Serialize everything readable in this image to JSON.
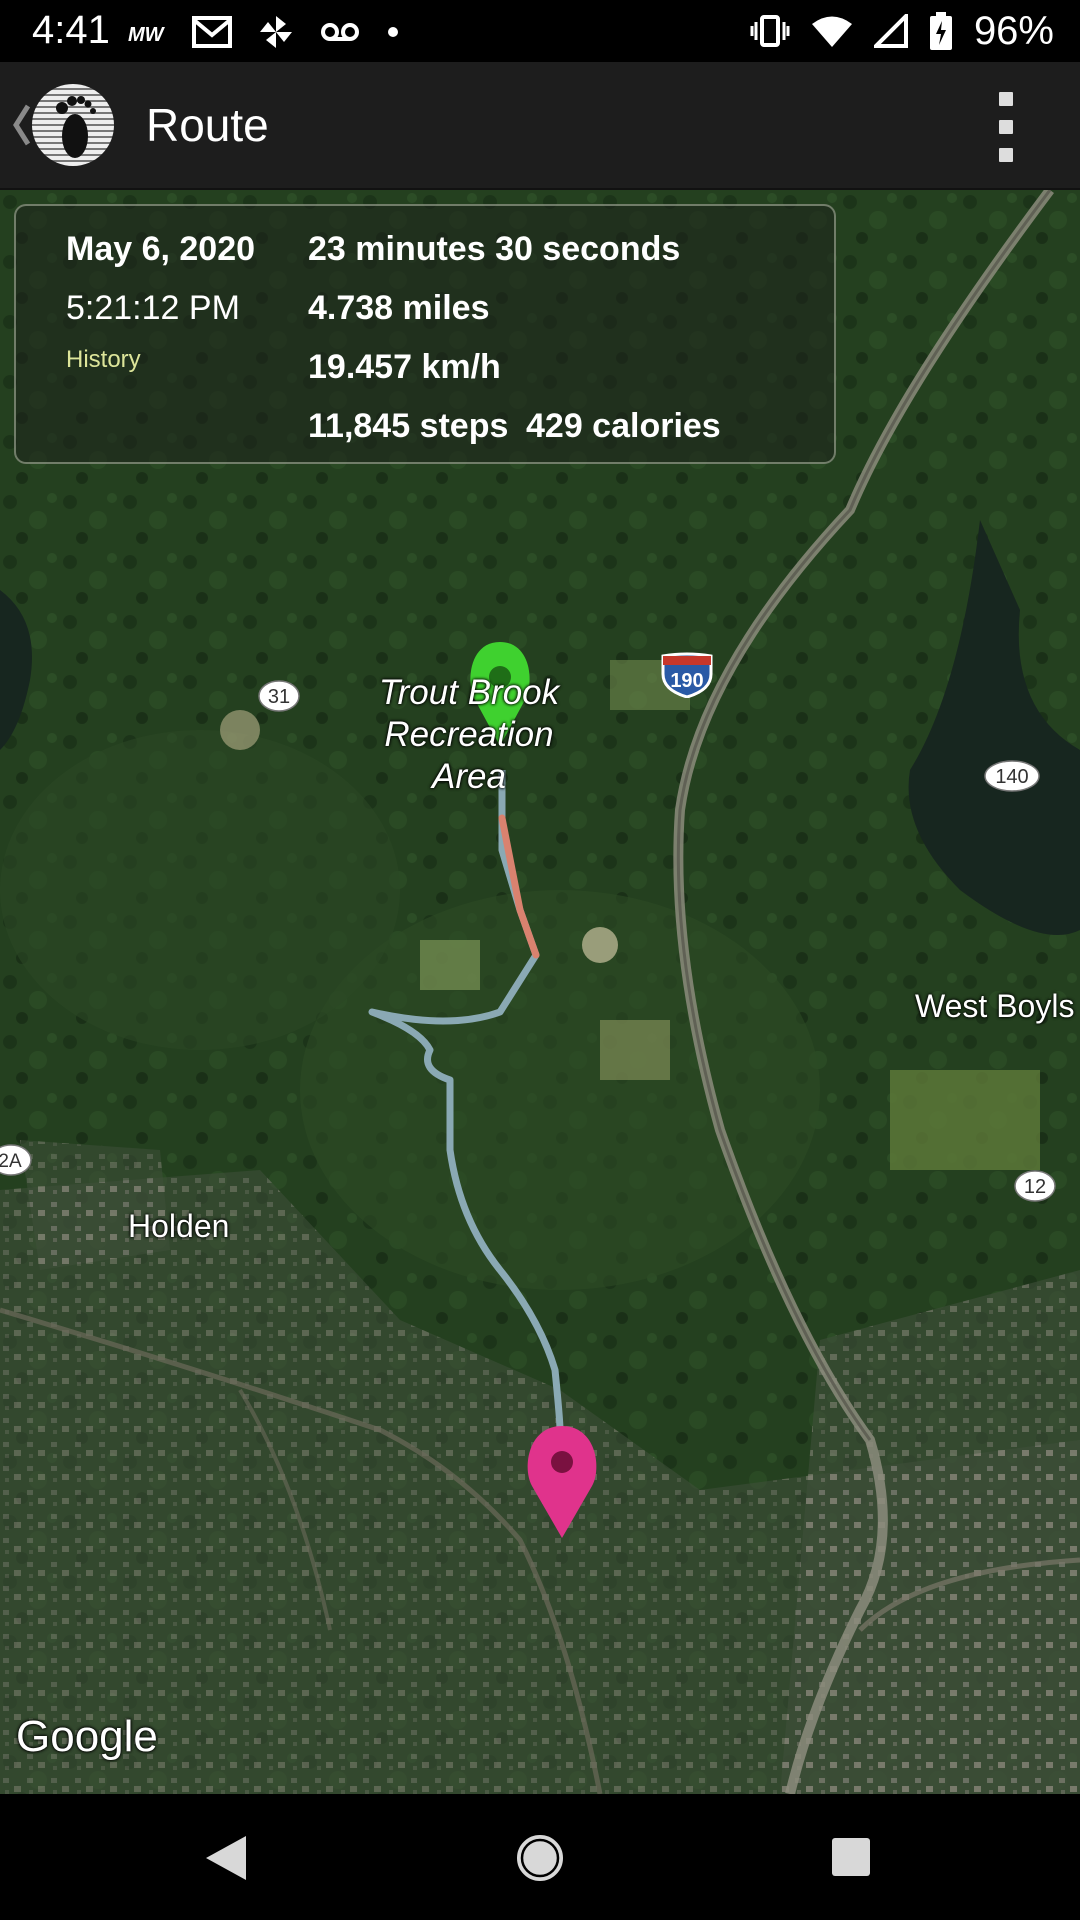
{
  "status_bar": {
    "time": "4:41",
    "battery_percent": "96%",
    "left_icons": [
      "mw-icon",
      "gmail-icon",
      "pinwheel-icon",
      "voicemail-icon",
      "dot-icon"
    ],
    "right_icons": [
      "vibrate-icon",
      "wifi-icon",
      "signal-icon",
      "battery-charging-icon"
    ]
  },
  "app_bar": {
    "title": "Route",
    "logo": "footprint-logo",
    "menu": "overflow-menu-icon"
  },
  "info": {
    "date": "May 6, 2020",
    "time": "5:21:12 PM",
    "history_link": "History",
    "duration": "23 minutes 30 seconds",
    "distance": "4.738 miles",
    "speed": "19.457 km/h",
    "steps": "11,845 steps",
    "calories": "429 calories"
  },
  "map": {
    "labels": {
      "area_line1": "Trout Brook",
      "area_line2": "Recreation",
      "area_line3": "Area",
      "west_boylston": "West Boyls",
      "holden": "Holden"
    },
    "shields": {
      "r31": "31",
      "i190": "190",
      "r140": "140",
      "r12": "12",
      "r122a": "2A"
    },
    "google_logo": "Google",
    "colors": {
      "route": "#8aa9b4",
      "route_fast": "#d9826f",
      "start_marker": "#3fd12f",
      "end_marker": "#e0338c"
    }
  },
  "nav_bar": {
    "back": "nav-back-icon",
    "home": "nav-home-icon",
    "recents": "nav-recents-icon"
  }
}
